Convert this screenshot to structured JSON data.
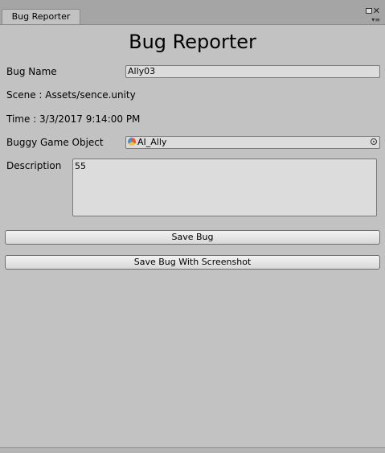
{
  "tab": {
    "label": "Bug Reporter"
  },
  "title": "Bug Reporter",
  "fields": {
    "bug_name_label": "Bug Name",
    "bug_name_value": "Ally03",
    "scene_text": "Scene : Assets/sence.unity",
    "time_text": "Time : 3/3/2017 9:14:00 PM",
    "game_object_label": "Buggy Game Object",
    "game_object_value": "AI_Ally",
    "description_label": "Description",
    "description_value": "55"
  },
  "buttons": {
    "save": "Save Bug",
    "save_screenshot": "Save Bug With Screenshot"
  },
  "icons": {
    "close": "close-icon",
    "pin": "pin-icon",
    "menu": "menu-icon",
    "object": "game-object-icon",
    "picker": "object-picker-icon"
  }
}
